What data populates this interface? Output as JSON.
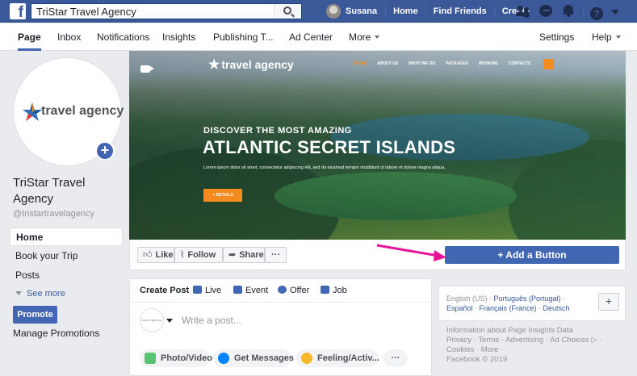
{
  "topbar": {
    "logo": "f",
    "search_value": "TriStar Travel Agency",
    "user_name": "Susana",
    "nav": [
      "Home",
      "Find Friends",
      "Create"
    ],
    "icons": [
      "friends-icon",
      "messenger-icon",
      "notifications-icon",
      "help-icon",
      "caret-down-icon"
    ],
    "help_glyph": "?"
  },
  "tabs": {
    "items": [
      "Page",
      "Inbox",
      "Notifications",
      "Insights",
      "Publishing T...",
      "Ad Center",
      "More"
    ],
    "right": [
      "Settings",
      "Help"
    ]
  },
  "profile": {
    "logo_text": "travel agency",
    "name": "TriStar Travel Agency",
    "handle": "@tristartravelagency",
    "add_glyph": "+"
  },
  "leftnav": {
    "items": [
      "Home",
      "Book your Trip",
      "Posts"
    ],
    "see_more": "See more",
    "promote": "Promote",
    "manage": "Manage Promotions"
  },
  "cover": {
    "logo": "travel agency",
    "nav": [
      "HOME",
      "ABOUT US",
      "WHAT WE DO",
      "PACKAGES",
      "BOOKING",
      "CONTACTS"
    ],
    "subtitle": "DISCOVER THE MOST AMAZING",
    "title": "ATLANTIC SECRET ISLANDS",
    "body": "Lorem ipsum dolor sit amet, consectetur adipiscing elit, sed do eiusmod tempor incididunt ut labore et dolore magna aliqua.",
    "button": "+ DETAILS",
    "accent": "#f58b1f"
  },
  "actions": {
    "like": "Like",
    "follow": "Follow",
    "share": "Share",
    "more": "···",
    "add_button": "Add a Button",
    "add_button_color": "#4267b2",
    "arrow_color": "#e5169a"
  },
  "composer": {
    "tabs": [
      "Create Post",
      "Live",
      "Event",
      "Offer",
      "Job"
    ],
    "avatar_text": "travel agency",
    "placeholder": "Write a post...",
    "pills": [
      "Photo/Video",
      "Get Messages",
      "Feeling/Activ...",
      "···"
    ]
  },
  "languages": {
    "current": "English (US)",
    "line1": [
      "Português (Portugal)"
    ],
    "line2": [
      "Español",
      "Français (France)",
      "Deutsch"
    ],
    "add": "+"
  },
  "footer": {
    "line1": "Information about Page Insights Data",
    "line2": "Privacy · Terms · Advertising · Ad Choices ▷ ·",
    "line3": "Cookies · More ·",
    "line4": "Facebook © 2019"
  }
}
